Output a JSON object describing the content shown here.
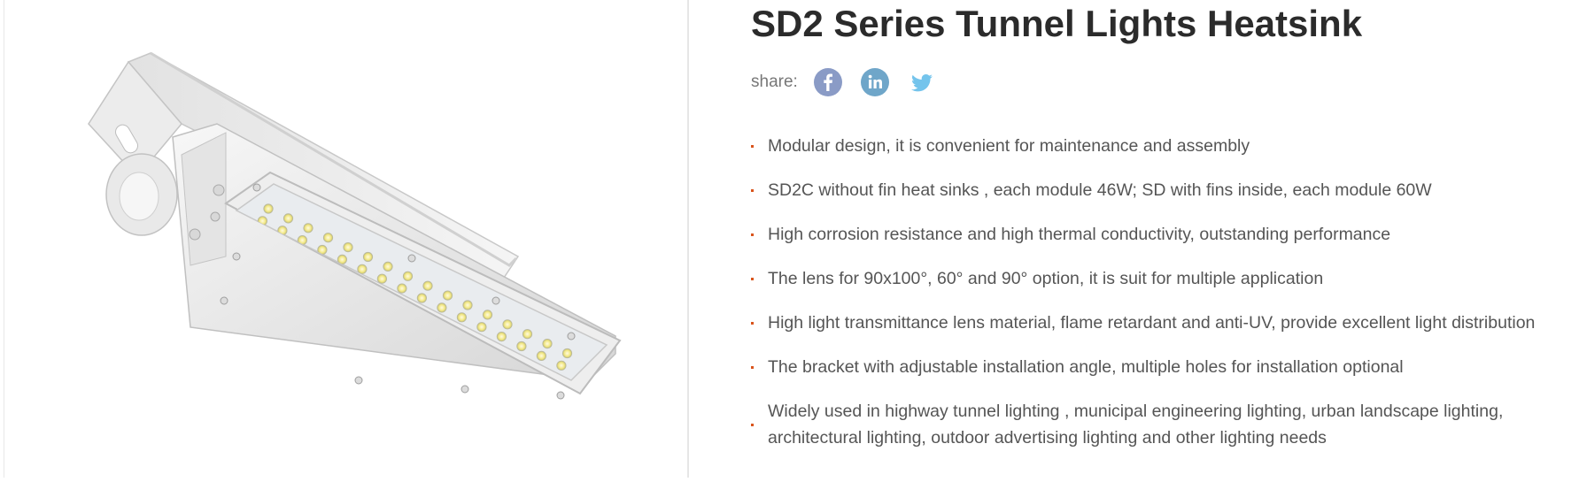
{
  "product": {
    "title": "SD2 Series Tunnel Lights Heatsink",
    "image_alt": "SD2 series tunnel light with adjustable bracket and LED lens module"
  },
  "share": {
    "label": "share:",
    "buttons": [
      {
        "network": "facebook",
        "icon": "facebook-icon",
        "glyph": "f",
        "color": "#8a9bc6"
      },
      {
        "network": "linkedin",
        "icon": "linkedin-icon",
        "glyph": "in",
        "color": "#6fa6c9"
      },
      {
        "network": "twitter",
        "icon": "twitter-icon",
        "glyph": "",
        "color": "#74c4ec"
      }
    ]
  },
  "features": [
    "Modular design, it is convenient for maintenance and assembly",
    "SD2C without fin heat sinks , each module 46W; SD with fins inside, each module 60W",
    "High corrosion resistance and high thermal conductivity, outstanding performance",
    "The lens for 90x100°, 60° and 90° option, it is suit for multiple application",
    "High light transmittance lens material, flame retardant and anti-UV, provide excellent light distribution",
    "The bracket with adjustable installation angle, multiple holes for installation optional",
    "Widely used in highway tunnel lighting , municipal engineering lighting, urban landscape lighting, architectural lighting, outdoor advertising lighting and other lighting needs"
  ],
  "colors": {
    "title": "#2b2b2b",
    "text": "#555555",
    "bullet": "#d9541c",
    "divider": "#e6e6e6"
  }
}
